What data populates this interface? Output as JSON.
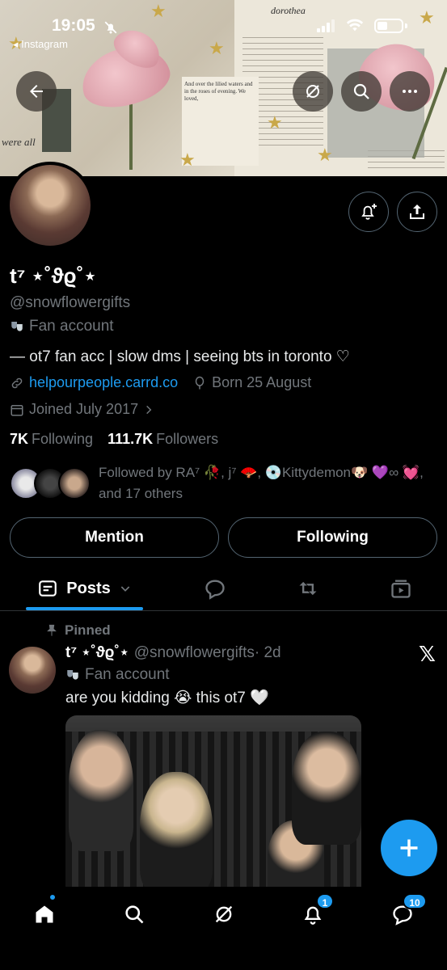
{
  "status_bar": {
    "time": "19:05",
    "back_app": "◂ Instagram"
  },
  "banner": {
    "script_text": "dorothea",
    "left_text": "were all",
    "verse": "And over the lilied waters and in the roses of evening. We loved,"
  },
  "profile": {
    "name": "t⁷ ⋆˚ϑϱ˚⋆",
    "handle": "@snowflowergifts",
    "category": "Fan account",
    "bio": "— ot7 fan acc | slow dms | seeing bts in toronto ♡",
    "link": "helpourpeople.carrd.co",
    "born": "Born 25 August",
    "joined": "Joined July 2017",
    "following_count": "7K",
    "following_label": "Following",
    "followers_count": "111.7K",
    "followers_label": "Followers",
    "followed_by": "Followed by RA⁷ 🥀, j⁷ 🪭, 💿Kittydemon🐶 💜∞ 💓, and 17 others"
  },
  "actions": {
    "mention_label": "Mention",
    "following_label": "Following"
  },
  "tabs": {
    "posts_label": "Posts"
  },
  "post": {
    "pinned_label": "Pinned",
    "author_name": "t⁷ ⋆˚ϑϱ˚⋆",
    "author_handle": "@snowflowergifts",
    "time": "· 2d",
    "category": "Fan account",
    "text": "are you kidding 😭 this ot7 🤍"
  },
  "bottom_nav": {
    "notifications_badge": "1",
    "messages_badge": "10"
  },
  "colors": {
    "accent": "#1d9bf0",
    "background": "#000000",
    "muted_text": "#71767b",
    "border": "#536471"
  }
}
